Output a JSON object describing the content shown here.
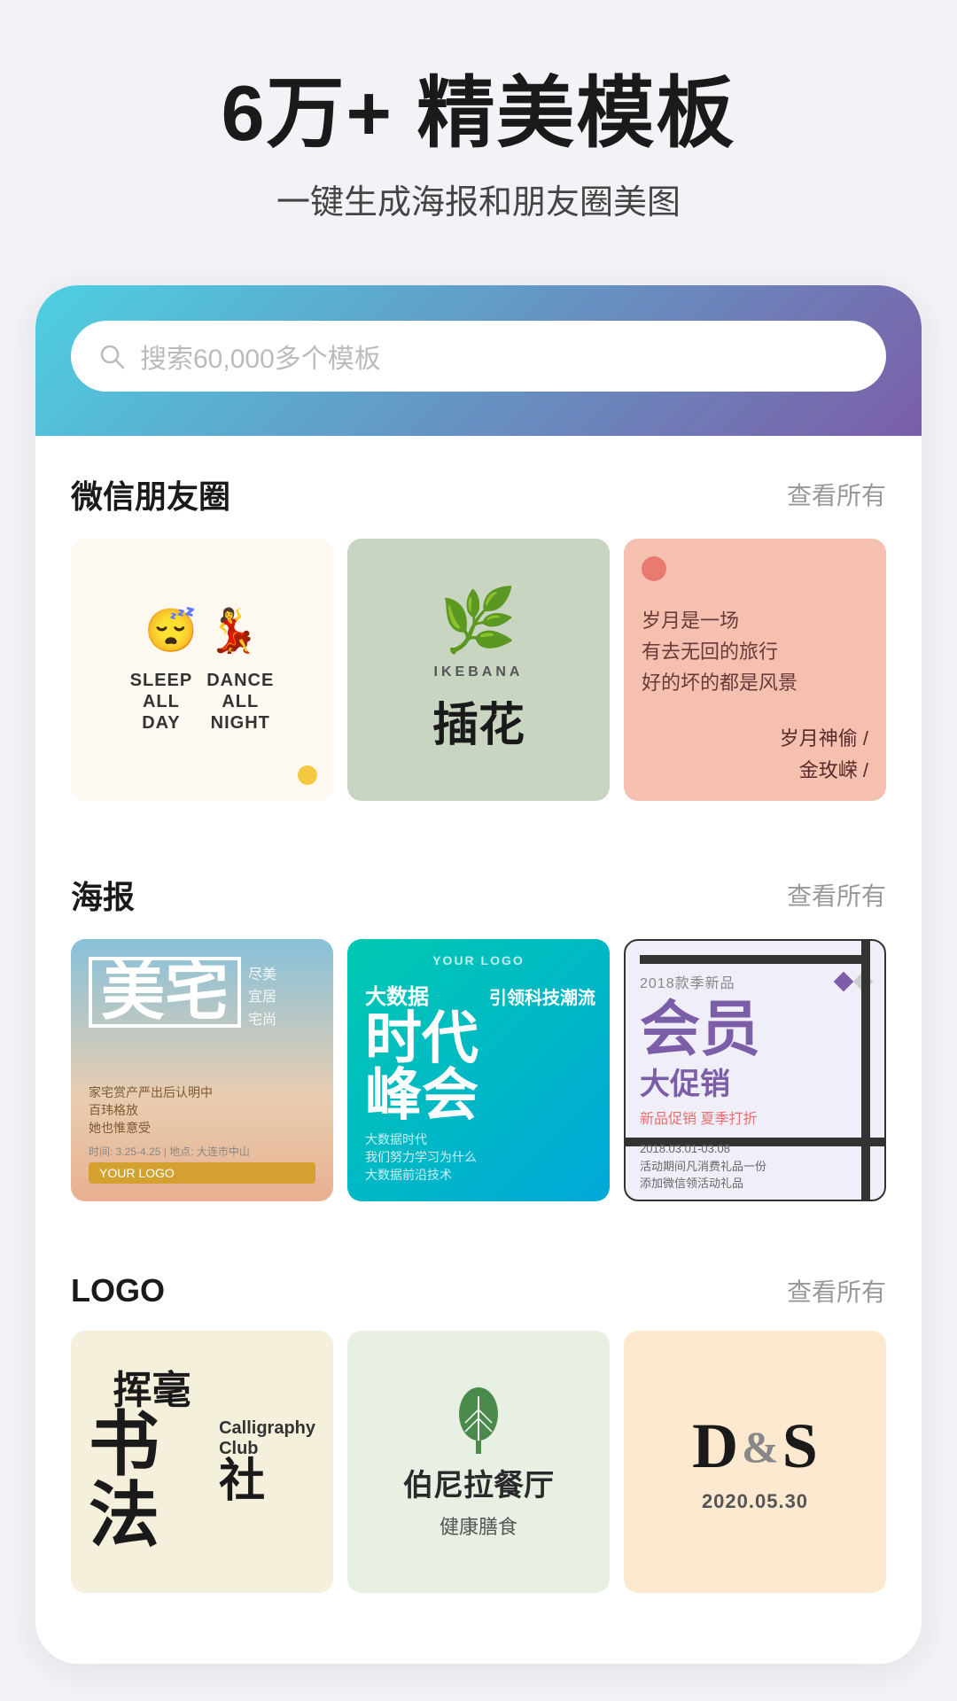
{
  "hero": {
    "title": "6万+ 精美模板",
    "subtitle": "一键生成海报和朋友圈美图"
  },
  "search": {
    "placeholder": "搜索60,000多个模板"
  },
  "sections": {
    "wechat": {
      "title": "微信朋友圈",
      "link": "查看所有",
      "cards": [
        {
          "type": "sleep-dance",
          "label1": "SLEEP ALL DAY",
          "label2": "DANCE ALL NIGHT"
        },
        {
          "type": "ikebana",
          "en": "IKEBANA",
          "zh": "插花"
        },
        {
          "type": "poem",
          "line1": "岁月是一场",
          "line2": "有去无回的旅行",
          "line3": "好的坏的都是风景",
          "author1": "岁月神偷 /",
          "author2": "金玫嵘 /"
        }
      ]
    },
    "poster": {
      "title": "海报",
      "link": "查看所有",
      "cards": [
        {
          "type": "meizhai",
          "main": "美宅",
          "sub1": "尽美",
          "sub2": "宜居",
          "sub3": "宅尚",
          "bottom": "YOUR LOGO"
        },
        {
          "type": "bigdata",
          "logo": "YOUR LOGO",
          "line1": "引领科技潮流",
          "main1": "时代",
          "main2": "峰会",
          "pre": "大数据",
          "desc": "大数据时代"
        },
        {
          "type": "member",
          "year": "2018款季新品",
          "main1": "会员",
          "main2": "大促销",
          "sub": "新品促销 夏季打折",
          "date1": "2018.03.01-03.08"
        }
      ]
    },
    "logo": {
      "title": "LOGO",
      "link": "查看所有",
      "cards": [
        {
          "type": "calligraphy",
          "zh1": "挥毫",
          "zh2": "书法",
          "en1": "Calligraphy",
          "en2": "Club",
          "zh3": "社"
        },
        {
          "type": "restaurant",
          "name": "伯尼拉餐厅",
          "sub": "健康膳食"
        },
        {
          "type": "ds",
          "letters": "D&S",
          "date": "2020.05.30"
        }
      ]
    }
  }
}
